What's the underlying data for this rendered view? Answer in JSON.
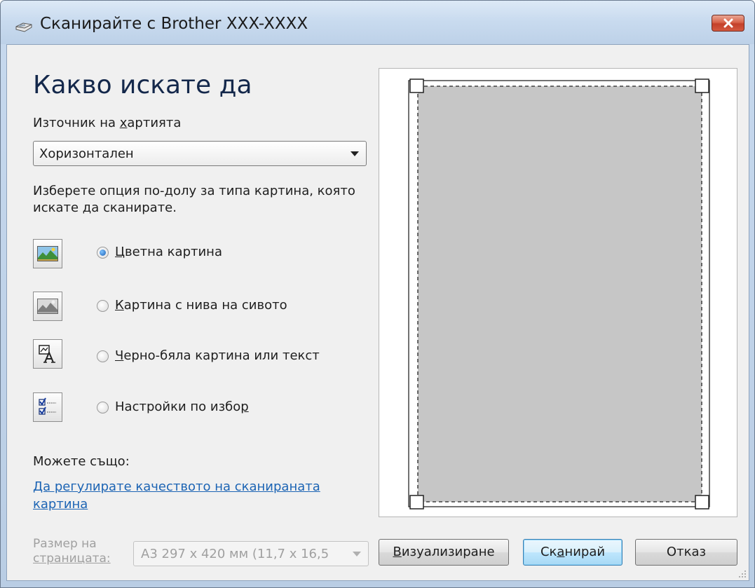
{
  "window": {
    "title": "Сканирайте с Brother XXX-XXXX"
  },
  "heading": "Какво искате да",
  "paper_source": {
    "label": "Източник на хартията",
    "label_accel_pre": "Източник на ",
    "label_accel_key": "х",
    "label_accel_post": "артията",
    "value": "Хоризонтален"
  },
  "instruction": "Изберете опция по-долу за типа картина, която искате да сканирате.",
  "options": [
    {
      "pre": "",
      "key": "Ц",
      "post": "ветна картина",
      "checked": true,
      "icon": "color-picture-icon"
    },
    {
      "pre": "",
      "key": "К",
      "post": "артина с нива на сивото",
      "checked": false,
      "icon": "grayscale-picture-icon"
    },
    {
      "pre": "",
      "key": "Ч",
      "post": "ерно-бяла картина или текст",
      "checked": false,
      "icon": "black-white-text-icon"
    },
    {
      "pre": "Настройки по избо",
      "key": "р",
      "post": "",
      "checked": false,
      "icon": "custom-settings-icon"
    }
  ],
  "also": {
    "label": "Можете също:",
    "link": "Да регулирате качеството на сканираната картина"
  },
  "page_size": {
    "label_line1": "Размер на",
    "label_line2": "страницата:",
    "value": "A3 297 x 420 мм (11,7 x 16,5"
  },
  "buttons": {
    "preview_key": "В",
    "preview_rest": "изуализиране",
    "scan_pre": "Ск",
    "scan_key": "а",
    "scan_post": "нирай",
    "cancel": "Отказ"
  },
  "colors": {
    "link": "#1c64b4",
    "heading": "#14284b",
    "close_button": "#c3402a"
  }
}
